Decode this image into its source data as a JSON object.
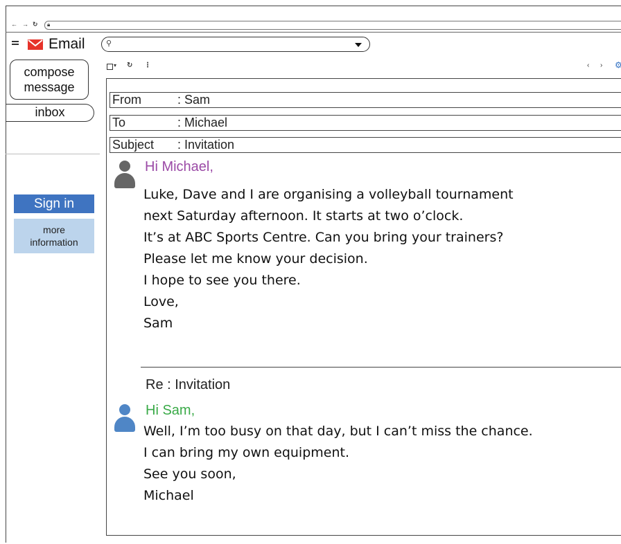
{
  "browser": {
    "back_icon": "arrow-left",
    "forward_icon": "arrow-right",
    "reload_icon": "reload",
    "lock_icon": "lock"
  },
  "app": {
    "title": "Email",
    "brand_color": "#e6332a"
  },
  "search": {
    "placeholder": "",
    "icon": "search"
  },
  "sidebar": {
    "compose_label": "compose message",
    "inbox_label": "inbox",
    "sign_in_label": "Sign in",
    "more_info_label": "more information",
    "sign_in_color": "#3f74c1",
    "more_info_color": "#bcd4ec"
  },
  "toolbar": {
    "select_dropdown_glyph": "▾",
    "reload_glyph": "↻",
    "more_glyph": "⋮",
    "prev_glyph": "‹",
    "next_glyph": "›",
    "settings_icon": "gear"
  },
  "email": {
    "from_label": "From",
    "from_value": ": Sam",
    "to_label": "To",
    "to_value": ": Michael",
    "subject_label": "Subject",
    "subject_value": ": Invitation",
    "greeting": "Hi Michael,",
    "greeting_color": "#9b4aa6",
    "body": [
      "Luke, Dave and I are organising a volleyball tournament",
      "next Saturday afternoon. It starts at two o’clock.",
      "It’s at ABC Sports Centre. Can you bring your trainers?",
      "Please let me know your decision.",
      "I hope to see you there.",
      "Love,",
      "Sam"
    ]
  },
  "reply": {
    "title": "Re : Invitation",
    "greeting": "Hi Sam,",
    "greeting_color": "#3aaa48",
    "body": [
      "Well, I’m too busy on that day, but I can’t miss the chance.",
      "I can bring my own equipment.",
      "See you soon,",
      "Michael"
    ]
  }
}
